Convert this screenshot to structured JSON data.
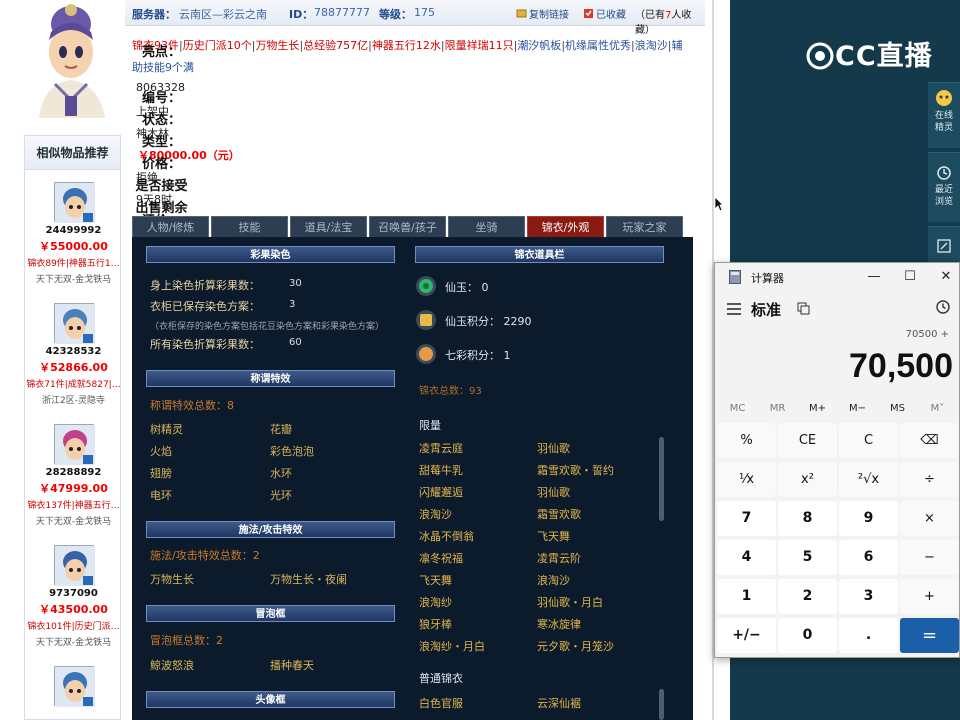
{
  "top": {
    "server_label": "服务器：",
    "server_value": "云南区—彩云之南",
    "id_label": "ID：",
    "id_value": "78877777",
    "level_label": "等级：",
    "level_value": "175",
    "copy_link": "复制链接",
    "favorited": "已收藏",
    "fav_count_prefix": "（已有",
    "fav_count": "7",
    "fav_count_suffix": "人收藏）"
  },
  "highlights": {
    "label": "亮点：",
    "items": [
      "锦衣93件",
      "历史门派10个",
      "万物生长",
      "总经验757亿",
      "神器五行12水",
      "限量祥瑞11只",
      "潮汐帆板",
      "机缘属性优秀",
      "浪淘沙",
      "辅助技能9个满"
    ]
  },
  "info": {
    "number_label": "编号：",
    "number_value": "8063328",
    "status_label": "状态：",
    "status_value": "上架中",
    "type_label": "类型：",
    "type_value": "神木林",
    "price_label": "价格：",
    "price_value": "￥80000.00（元）",
    "bargain_label": "是否接受还价：",
    "bargain_value": "拒绝",
    "remaining_label": "出售剩余时间：",
    "remaining_value": "9天8时"
  },
  "tabs": [
    "人物/修炼",
    "技能",
    "道具/法宝",
    "召唤兽/孩子",
    "坐骑",
    "锦衣/外观",
    "玩家之家"
  ],
  "panel": {
    "dye_title": "彩果染色",
    "dye_rows": [
      {
        "label": "身上染色折算彩果数：",
        "value": "30"
      },
      {
        "label": "衣柜已保存染色方案：",
        "value": "3"
      },
      {
        "label": "所有染色折算彩果数：",
        "value": "60"
      }
    ],
    "dye_note": "（衣柜保存的染色方案包括花豆染色方案和彩果染色方案）",
    "title_effect_title": "称谓特效",
    "title_effect_total": "称谓特效总数：8",
    "title_effects": [
      "树精灵",
      "花瓣",
      "火焰",
      "彩色泡泡",
      "翅膀",
      "水环",
      "电环",
      "光环"
    ],
    "spell_title": "施法/攻击特效",
    "spell_total": "施法/攻击特效总数：2",
    "spells": [
      "万物生长",
      "万物生长・夜阑"
    ],
    "bubble_title": "冒泡框",
    "bubble_total": "冒泡框总数：2",
    "bubbles": [
      "鲸波怒浪",
      "播种春天"
    ],
    "avatar_frame_title": "头像框",
    "wardrobe_title": "锦衣道具栏",
    "wardrobe_items": [
      {
        "label": "仙玉：",
        "value": "0"
      },
      {
        "label": "仙玉积分：",
        "value": "2290"
      },
      {
        "label": "七彩积分：",
        "value": "1"
      }
    ],
    "jinyi_total": "锦衣总数：93",
    "limited_title": "限量",
    "limited": [
      "凌霄云庭",
      "羽仙歌",
      "甜莓牛乳",
      "霜雪欢歌・誓约",
      "闪耀邂逅",
      "羽仙歌",
      "浪淘沙",
      "霜雪欢歌",
      "冰晶不倒翁",
      "飞天舞",
      "凛冬祝福",
      "凌霄云阶",
      "飞天舞",
      "浪淘沙",
      "浪淘纱",
      "羽仙歌・月白",
      "狼牙棒",
      "寒冰旋律",
      "浪淘纱・月白",
      "元夕歌・月笼沙"
    ],
    "normal_title": "普通锦衣",
    "normal": [
      "白色官服",
      "云深仙裾"
    ]
  },
  "similar": {
    "title": "相似物品推荐",
    "items": [
      {
        "id": "24499992",
        "price": "￥55000.00",
        "highlights": "锦衣89件|神器五行1…",
        "server": "天下无双-金戈铁马",
        "color": "#3b6fb6"
      },
      {
        "id": "42328532",
        "price": "￥52866.00",
        "highlights": "锦衣71件|成就5827|…",
        "server": "浙江2区-灵隐寺",
        "color": "#4a7fc0"
      },
      {
        "id": "28288892",
        "price": "￥47999.00",
        "highlights": "锦衣137件|神器五行…",
        "server": "天下无双-金戈铁马",
        "color": "#c0408a"
      },
      {
        "id": "9737090",
        "price": "￥43500.00",
        "highlights": "锦衣101件|历史门派…",
        "server": "天下无双-金戈铁马",
        "color": "#3561a8"
      },
      {
        "id": "",
        "price": "",
        "highlights": "",
        "server": "",
        "color": "#3b73b8"
      }
    ]
  },
  "cc": {
    "logo": "CC直播",
    "tiles": [
      {
        "label": "在线精灵",
        "icon": "sprite-icon"
      },
      {
        "label": "最近浏览",
        "icon": "clock-icon"
      },
      {
        "label": "",
        "icon": "edit-icon"
      }
    ]
  },
  "calculator": {
    "title": "计算器",
    "mode": "标准",
    "expression": "70500 +",
    "display": "70,500",
    "memory": [
      "MC",
      "MR",
      "M+",
      "M−",
      "MS",
      "M˅"
    ],
    "keys": [
      "%",
      "CE",
      "C",
      "⌫",
      "⅟x",
      "x²",
      "²√x",
      "÷",
      "7",
      "8",
      "9",
      "×",
      "4",
      "5",
      "6",
      "−",
      "1",
      "2",
      "3",
      "+",
      "+/−",
      "0",
      ".",
      "="
    ]
  }
}
